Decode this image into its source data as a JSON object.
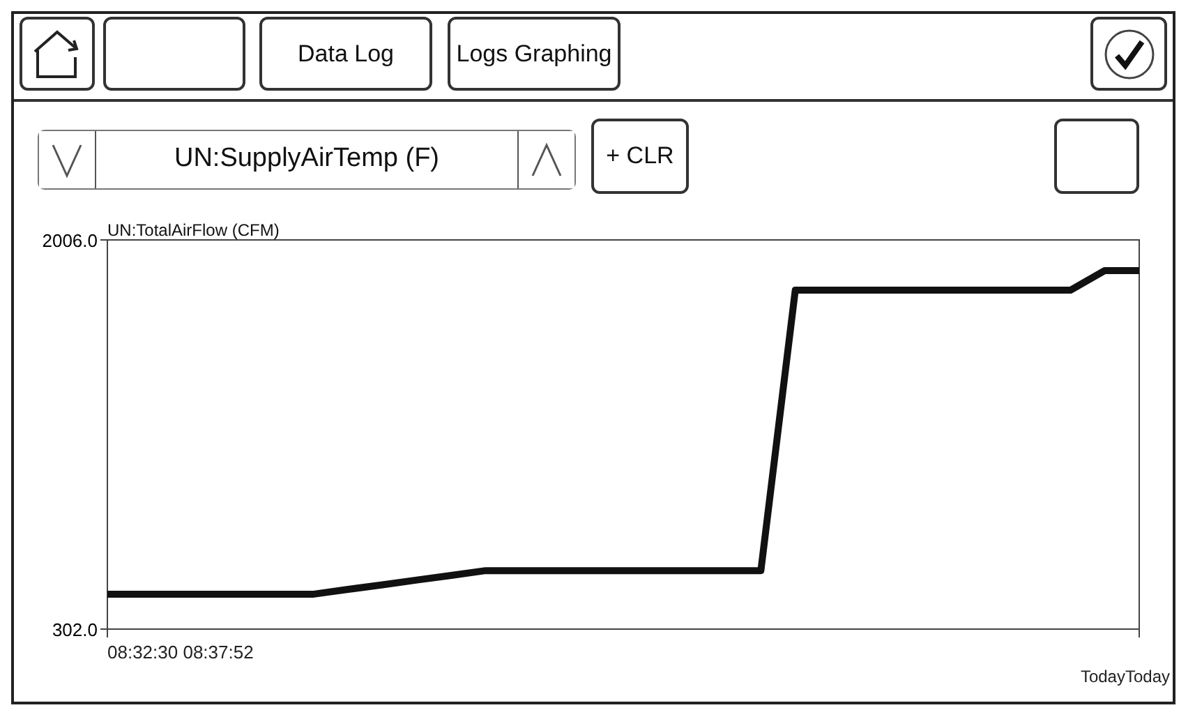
{
  "toolbar": {
    "buttons": [
      {
        "kind": "home"
      },
      {
        "kind": "blank"
      },
      {
        "kind": "text",
        "label": "Data Log"
      },
      {
        "kind": "text",
        "label": "Logs Graphing"
      },
      {
        "kind": "ok"
      }
    ]
  },
  "selector": {
    "value": "UN:SupplyAirTemp (F)"
  },
  "actions": [
    {
      "kind": "text",
      "label": "+ CLR"
    },
    {
      "kind": "blank"
    }
  ],
  "chart": {
    "x_labels": [
      "08:32:30 08:37:52",
      "TodayToday"
    ],
    "chart_data": {
      "type": "line",
      "categories": [
        null,
        null,
        null,
        null,
        null,
        null,
        null,
        null,
        null,
        null,
        null,
        null,
        null,
        null,
        null,
        null,
        null,
        null,
        null,
        null,
        null,
        null,
        null,
        null,
        null,
        null,
        null,
        null,
        null,
        null,
        null
      ],
      "ylim": [
        302,
        2006
      ],
      "yticks": [
        {
          "value": 302,
          "label": "302.0"
        },
        {
          "value": 2006,
          "label": "2006.0"
        }
      ],
      "series": [
        {
          "name": "UN:TotalAirFlow (CFM)",
          "color": "#111111",
          "values": [
            455,
            455,
            455,
            455,
            455,
            455,
            455,
            476,
            496,
            517,
            537,
            558,
            558,
            558,
            558,
            558,
            558,
            558,
            558,
            558,
            1786,
            1786,
            1786,
            1786,
            1786,
            1786,
            1786,
            1786,
            1786,
            1872,
            1872
          ]
        }
      ]
    }
  }
}
